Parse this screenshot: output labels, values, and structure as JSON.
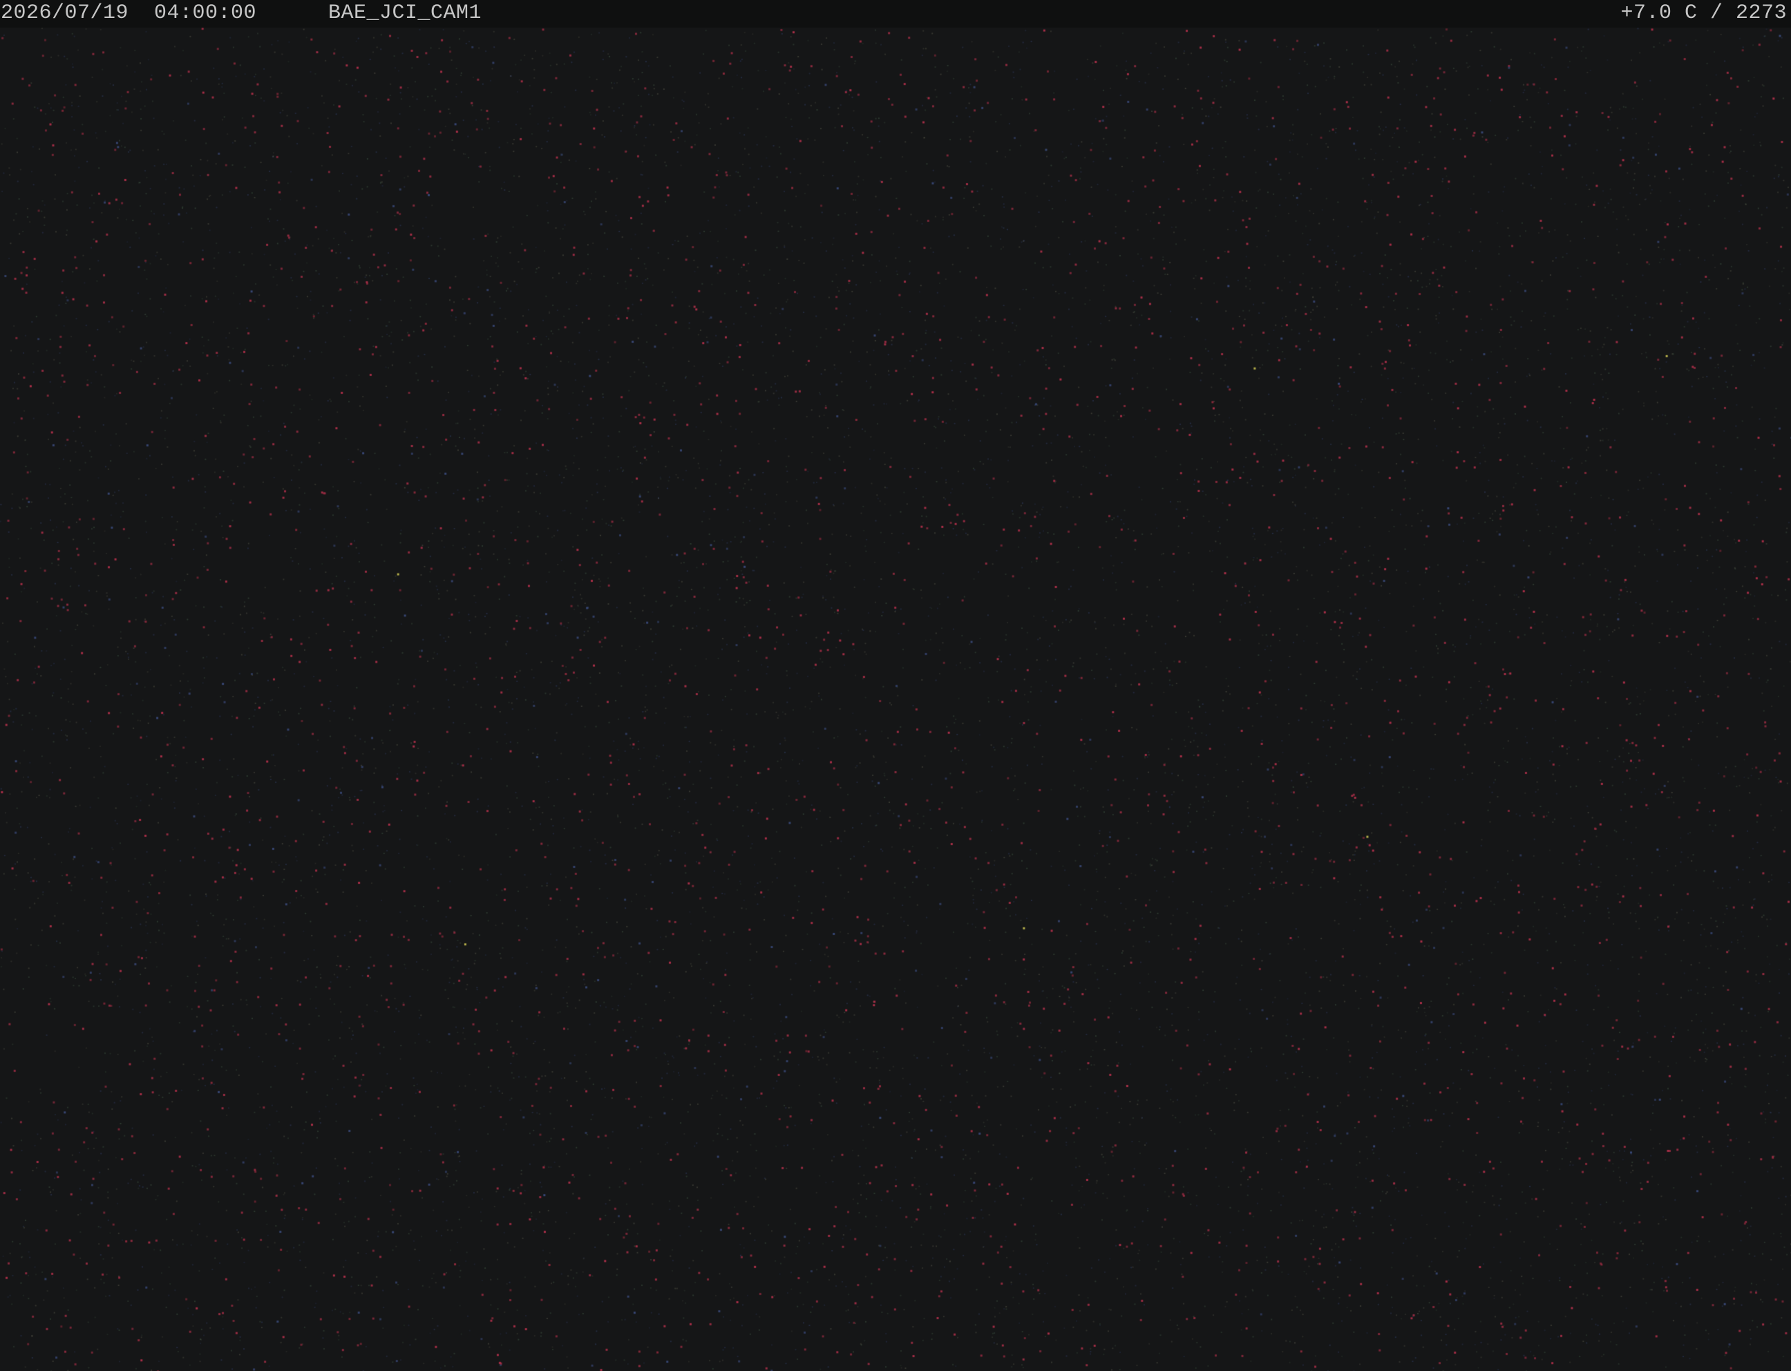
{
  "overlay": {
    "timestamp": "2026/07/19  04:00:00",
    "camera_id": "BAE_JCI_CAM1",
    "sensor_readout": "+7.0 C / 2273"
  },
  "colors": {
    "frame_background": "#151617",
    "header_background": "#0f1010",
    "overlay_text": "#c6c6c6",
    "noise_palette": [
      "#b0304a",
      "#8e2a3c",
      "#4e6a52",
      "#3a4a7a",
      "#6a6a58",
      "#c8c050"
    ]
  }
}
